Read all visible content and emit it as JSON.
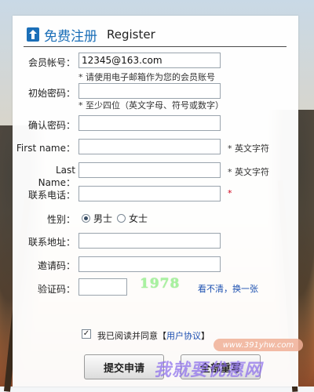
{
  "title": {
    "cn": "免费注册",
    "en": "Register"
  },
  "form": {
    "account": {
      "label": "会员帐号：",
      "value": "12345@163.com",
      "hint": "* 请使用电子邮箱作为您的会员账号"
    },
    "password": {
      "label": "初始密码：",
      "value": "",
      "hint": "* 至少四位（英文字母、符号或数字）"
    },
    "confirm": {
      "label": "确认密码：",
      "value": ""
    },
    "first_name": {
      "label": "First name：",
      "value": "",
      "hint": "* 英文字符"
    },
    "last_name": {
      "label": "Last Name：",
      "value": "",
      "hint": "* 英文字符"
    },
    "phone": {
      "label": "联系电话：",
      "value": "",
      "hint": "*"
    },
    "gender": {
      "label": "性别：",
      "options": [
        "男士",
        "女士"
      ],
      "selected": "男士"
    },
    "address": {
      "label": "联系地址：",
      "value": ""
    },
    "invite": {
      "label": "邀请码：",
      "value": ""
    },
    "captcha": {
      "label": "验证码：",
      "value": "",
      "code": "1978",
      "refresh": "看不清，换一张"
    },
    "agree": {
      "checked": true,
      "prefix": "我已阅读并同意",
      "open": "【",
      "link": "用户协议",
      "close": "】"
    }
  },
  "buttons": {
    "submit": "提交申请",
    "reset": "全部重写"
  },
  "watermark": {
    "site": "www.391yhw.com",
    "text": "我就要优惠网"
  }
}
